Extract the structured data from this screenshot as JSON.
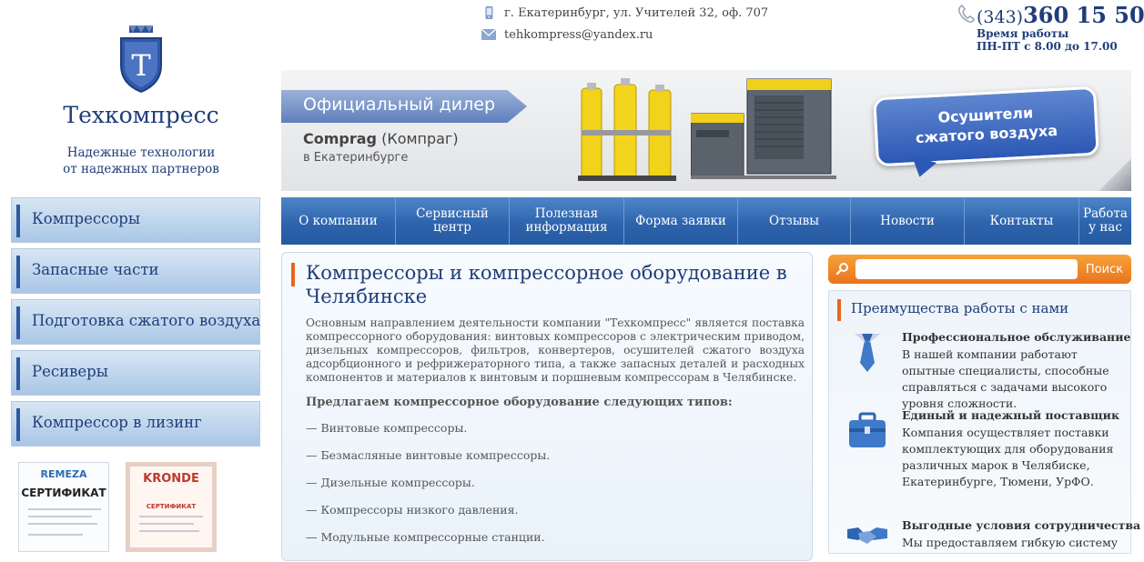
{
  "site": {
    "name": "Техкомпресс",
    "tagline_line1": "Надежные технологии",
    "tagline_line2": "от надежных партнеров",
    "logo_letter": "Т"
  },
  "contacts": {
    "address": "г. Екатеринбург, ул. Учителей 32, оф. 707",
    "email": "tehkompress@yandex.ru",
    "phone_code": "(343)",
    "phone_number": "360 15 50",
    "hours_label": "Время работы",
    "hours_value": "ПН-ПТ с 8.00 до 17.00"
  },
  "banner": {
    "ribbon": "Официальный дилер",
    "brand": "Comprag",
    "brand_note": "(Компраг)",
    "city": "в Екатеринбурге",
    "bubble_line1": "Осушители",
    "bubble_line2": "сжатого воздуха"
  },
  "topnav": [
    {
      "label": "О компании"
    },
    {
      "label": "Сервисный центр"
    },
    {
      "label": "Полезная информация"
    },
    {
      "label": "Форма заявки"
    },
    {
      "label": "Отзывы"
    },
    {
      "label": "Новости"
    },
    {
      "label": "Контакты"
    },
    {
      "label": "Работа у нас"
    }
  ],
  "leftmenu": [
    {
      "label": "Компрессоры"
    },
    {
      "label": "Запасные части"
    },
    {
      "label": "Подготовка сжатого воздуха"
    },
    {
      "label": "Ресиверы"
    },
    {
      "label": "Компрессор в лизинг"
    }
  ],
  "certificates": [
    {
      "brand": "REMEZA",
      "title": "СЕРТИФИКАТ"
    },
    {
      "brand": "KRONDE",
      "title": "СЕРТИФИКАТ"
    }
  ],
  "main": {
    "title": "Компрессоры и компрессорное оборудование в Челябинске",
    "paragraph": "Основным направлением деятельности компании \"Техкомпресс\" является поставка компрессорного оборудования: винтовых компрессоров с электрическим приводом, дизельных компрессоров, фильтров, конвертеров, осушителей сжатого воздуха адсорбционного и рефрижераторного типа, а также запасных деталей и расходных компонентов и материалов к винтовым и поршневым компрессорам в Челябинске.",
    "subtitle": "Предлагаем компрессорное оборудование следующих типов:",
    "list": [
      "—  Винтовые компрессоры.",
      "—  Безмасляные винтовые компрессоры.",
      "—  Дизельные компрессоры.",
      "—  Компрессоры низкого давления.",
      "—  Модульные компрессорные станции."
    ]
  },
  "search": {
    "placeholder": "",
    "button": "Поиск"
  },
  "advantages": {
    "title": "Преимущества работы с нами",
    "items": [
      {
        "icon": "tie-icon",
        "title": "Профессиональное обслуживание",
        "text": "В нашей компании работают опытные специалисты, способные справляться с задачами высокого уровня сложности."
      },
      {
        "icon": "briefcase-icon",
        "title": "Единый и надежный поставщик",
        "text": "Компания осуществляет поставки комплектующих для оборудования различных марок  в Челябиске, Екатеринбурге, Тюмени, УрФО."
      },
      {
        "icon": "handshake-icon",
        "title": "Выгодные условия сотрудничества",
        "text": "Мы предоставляем гибкую систему"
      }
    ]
  },
  "colors": {
    "brand_blue": "#1f3d7a",
    "nav_blue": "#2d64ad",
    "accent_orange": "#e8741d"
  }
}
